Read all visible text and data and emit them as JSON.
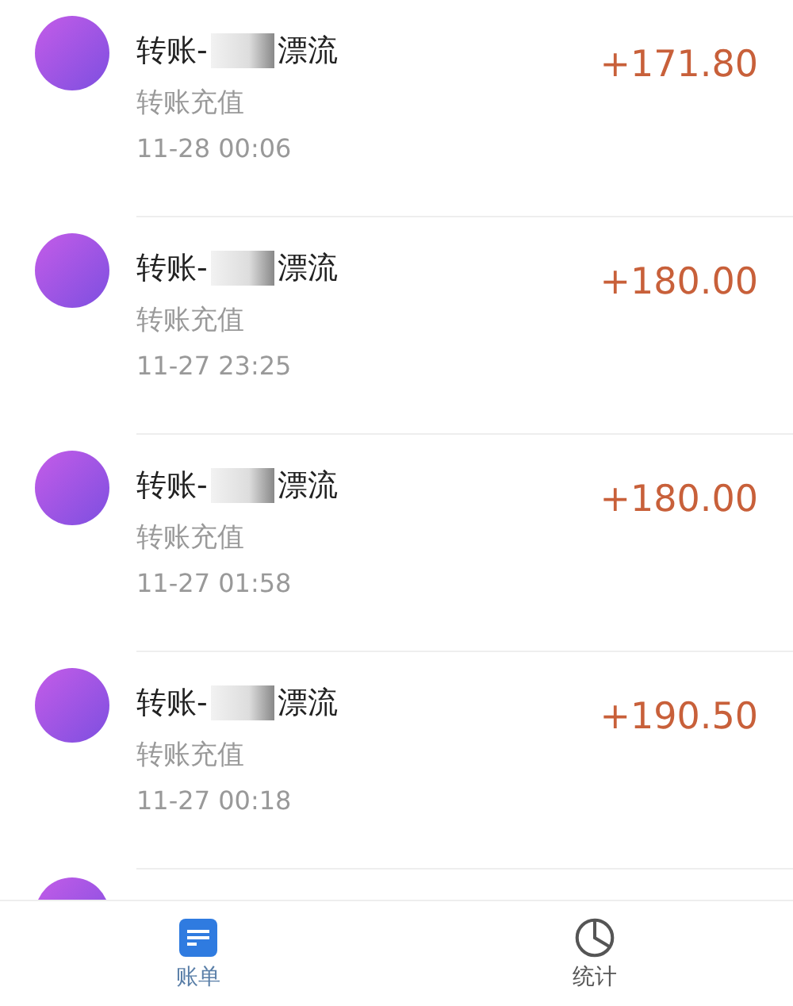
{
  "transactions": [
    {
      "title_prefix": "转账-",
      "title_suffix": "漂流",
      "redacted": true,
      "subtitle": "转账充值",
      "time": "11-28  00:06",
      "amount": "+171.80"
    },
    {
      "title_prefix": "转账-",
      "title_suffix": "漂流",
      "redacted": true,
      "subtitle": "转账充值",
      "time": "11-27  23:25",
      "amount": "+180.00"
    },
    {
      "title_prefix": "转账-",
      "title_suffix": "漂流",
      "redacted": true,
      "subtitle": "转账充值",
      "time": "11-27  01:58",
      "amount": "+180.00"
    },
    {
      "title_prefix": "转账-",
      "title_suffix": "漂流",
      "redacted": true,
      "subtitle": "转账充值",
      "time": "11-27  00:18",
      "amount": "+190.50"
    }
  ],
  "partial_row_visible": true,
  "tabs": [
    {
      "label": "账单",
      "kind": "bill",
      "selected": true
    },
    {
      "label": "统计",
      "kind": "stats",
      "selected": false
    }
  ]
}
